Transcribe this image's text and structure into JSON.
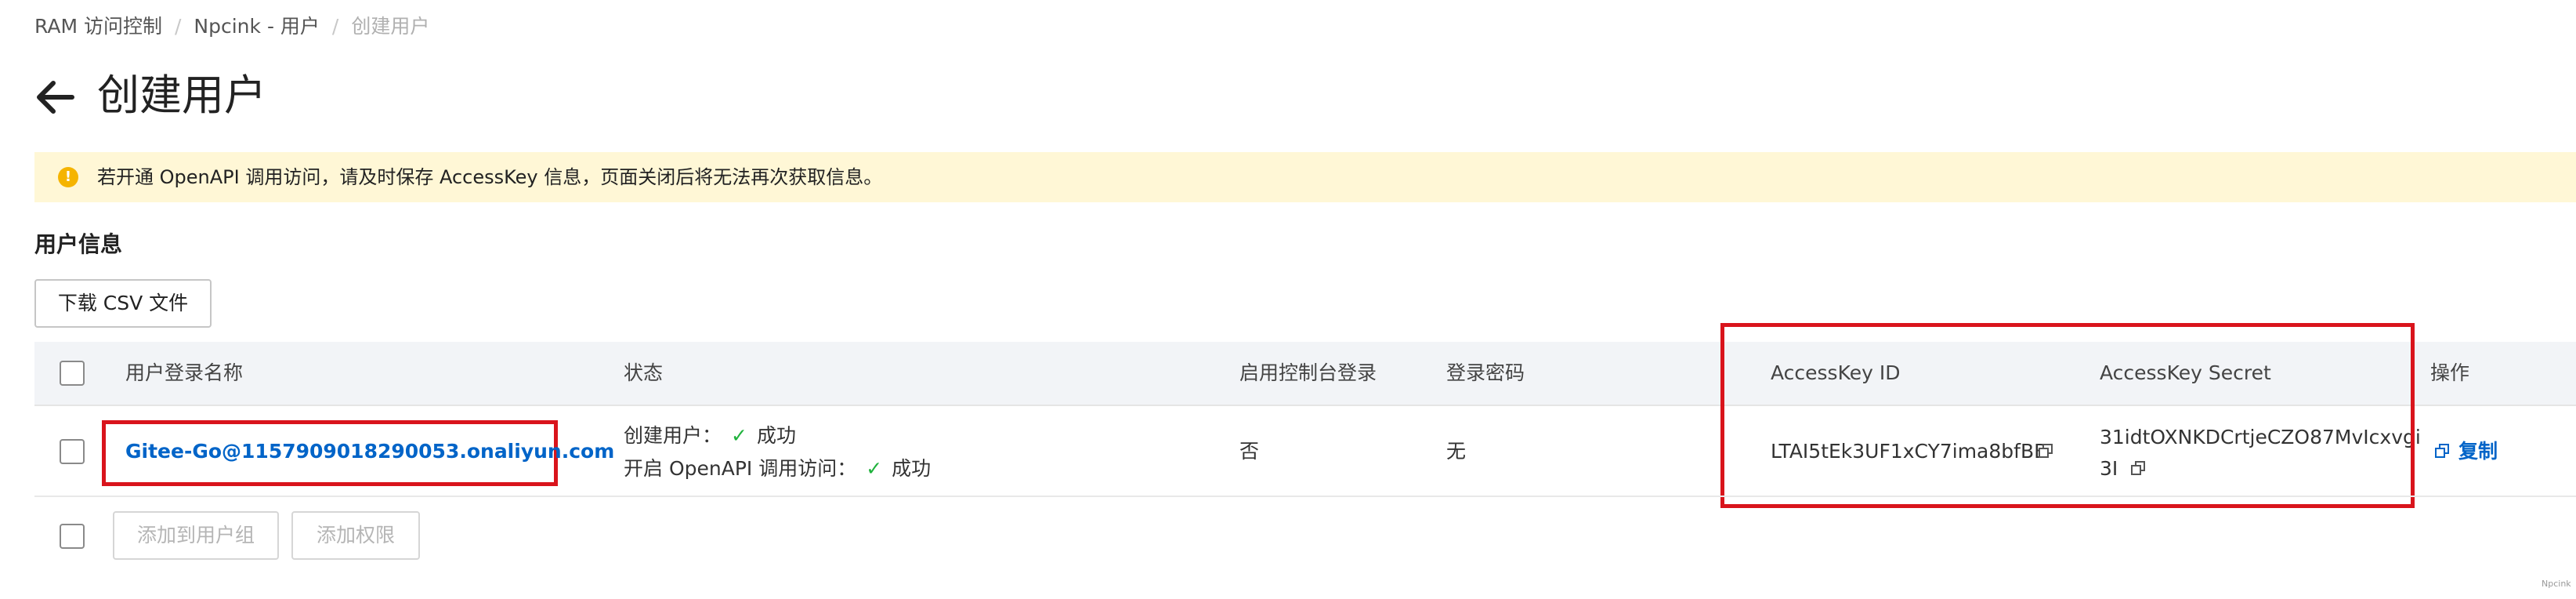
{
  "breadcrumb": {
    "items": [
      "RAM 访问控制",
      "Npcink - 用户",
      "创建用户"
    ],
    "separator": "/"
  },
  "page": {
    "title": "创建用户",
    "back_icon": "arrow-left-icon"
  },
  "alert": {
    "icon": "warning-circle-icon",
    "text": "若开通 OpenAPI 调用访问，请及时保存 AccessKey 信息，页面关闭后将无法再次获取信息。",
    "background": "#fff7d6",
    "icon_color": "#f5b400"
  },
  "section": {
    "title": "用户信息",
    "download_label": "下载 CSV 文件"
  },
  "table": {
    "headers": {
      "login_name": "用户登录名称",
      "status": "状态",
      "console_login": "启用控制台登录",
      "password": "登录密码",
      "access_key_id": "AccessKey ID",
      "access_key_secret": "AccessKey Secret",
      "actions": "操作"
    },
    "rows": [
      {
        "login_name": "Gitee-Go@1157909018290053.onaliyun.com",
        "status": [
          {
            "label": "创建用户：",
            "result": "成功"
          },
          {
            "label": "开启 OpenAPI 调用访问：",
            "result": "成功"
          }
        ],
        "console_login": "否",
        "password": "无",
        "access_key_id": "LTAI5tEk3UF1xCY7ima8bfBB",
        "access_key_secret_line1": "31idtOXNKDCrtjeCZO87MvIcxvgi",
        "access_key_secret_line2": "3I",
        "action_label": "复制"
      }
    ]
  },
  "footer_buttons": {
    "add_to_group": "添加到用户组",
    "add_permission": "添加权限"
  },
  "watermark": "Npcink",
  "colors": {
    "link": "#0064c8",
    "success": "#1fb23c",
    "highlight_box": "#d9141c"
  }
}
